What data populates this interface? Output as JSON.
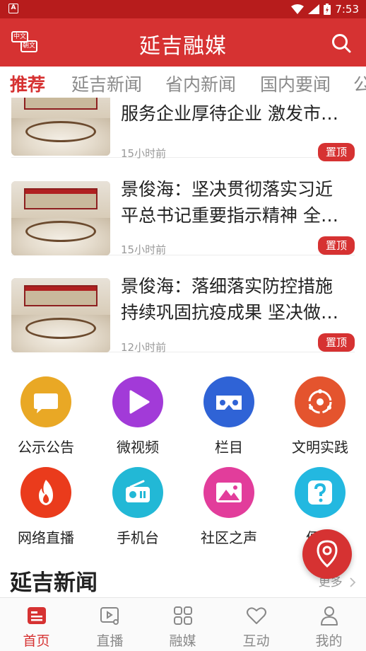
{
  "status_bar": {
    "time": "7:53",
    "left_icon": "A"
  },
  "header": {
    "title": "延吉融媒",
    "lang_switch": {
      "top_label": "中文",
      "bottom_label": "朝文"
    },
    "accent_color": "#d63232"
  },
  "tabs": [
    {
      "label": "推荐",
      "active": true
    },
    {
      "label": "延吉新闻",
      "active": false
    },
    {
      "label": "省内新闻",
      "active": false
    },
    {
      "label": "国内要闻",
      "active": false
    },
    {
      "label": "公",
      "active": false
    }
  ],
  "news": [
    {
      "title_line1": "",
      "title_line2": "服务企业厚待企业 激发市…",
      "time": "15小时前",
      "badge": "置顶"
    },
    {
      "title_line1": "景俊海：坚决贯彻落实习近",
      "title_line2": "平总书记重要指示精神 全…",
      "time": "15小时前",
      "badge": "置顶"
    },
    {
      "title_line1": "景俊海：落细落实防控措施",
      "title_line2": "持续巩固抗疫成果 坚决做…",
      "time": "12小时前",
      "badge": "置顶"
    }
  ],
  "grid": [
    {
      "label": "公示公告",
      "icon": "chat-bubble-icon",
      "color": "#e9a825"
    },
    {
      "label": "微视频",
      "icon": "play-icon",
      "color": "#a23ad8"
    },
    {
      "label": "栏目",
      "icon": "vr-glasses-icon",
      "color": "#2f63d6"
    },
    {
      "label": "文明实践",
      "icon": "network-icon",
      "color": "#e4542e"
    },
    {
      "label": "网络直播",
      "icon": "flame-icon",
      "color": "#ea3b1c"
    },
    {
      "label": "手机台",
      "icon": "radio-icon",
      "color": "#22b8d6"
    },
    {
      "label": "社区之声",
      "icon": "mountain-image-icon",
      "color": "#e23d9b"
    },
    {
      "label": "便民",
      "icon": "question-icon",
      "color": "#23b8e0"
    }
  ],
  "section": {
    "title": "延吉新闻",
    "more": "更多"
  },
  "bottom_nav": [
    {
      "label": "首页",
      "icon": "home-news-icon",
      "active": true
    },
    {
      "label": "直播",
      "icon": "live-music-icon",
      "active": false
    },
    {
      "label": "融媒",
      "icon": "grid-squares-icon",
      "active": false
    },
    {
      "label": "互动",
      "icon": "heart-icon",
      "active": false
    },
    {
      "label": "我的",
      "icon": "person-icon",
      "active": false
    }
  ]
}
